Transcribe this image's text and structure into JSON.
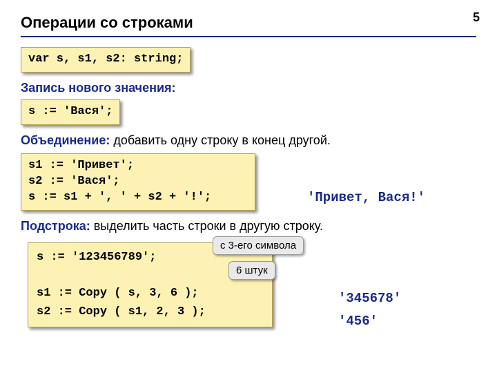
{
  "page_number": "5",
  "title": "Операции со строками",
  "declaration_code": "var s, s1, s2: string;",
  "section_assign": {
    "heading": "Запись нового значения:",
    "code": "s := 'Вася';"
  },
  "section_concat": {
    "lead": "Объединение:",
    "text": " добавить одну строку в конец другой.",
    "code": "s1 := 'Привет';\ns2 := 'Вася';\ns := s1 + ', ' + s2 + '!';",
    "result": "'Привет, Вася!'"
  },
  "section_substr": {
    "lead": "Подстрока:",
    "text": " выделить часть строки в другую строку.",
    "code": "s := '123456789';\n\ns1 := Copy ( s, 3, 6 );\ns2 := Copy ( s1, 2, 3 );",
    "callout_from": "с 3-его символа",
    "callout_count": "6 штук",
    "result1": "'345678'",
    "result2": "'456'"
  }
}
